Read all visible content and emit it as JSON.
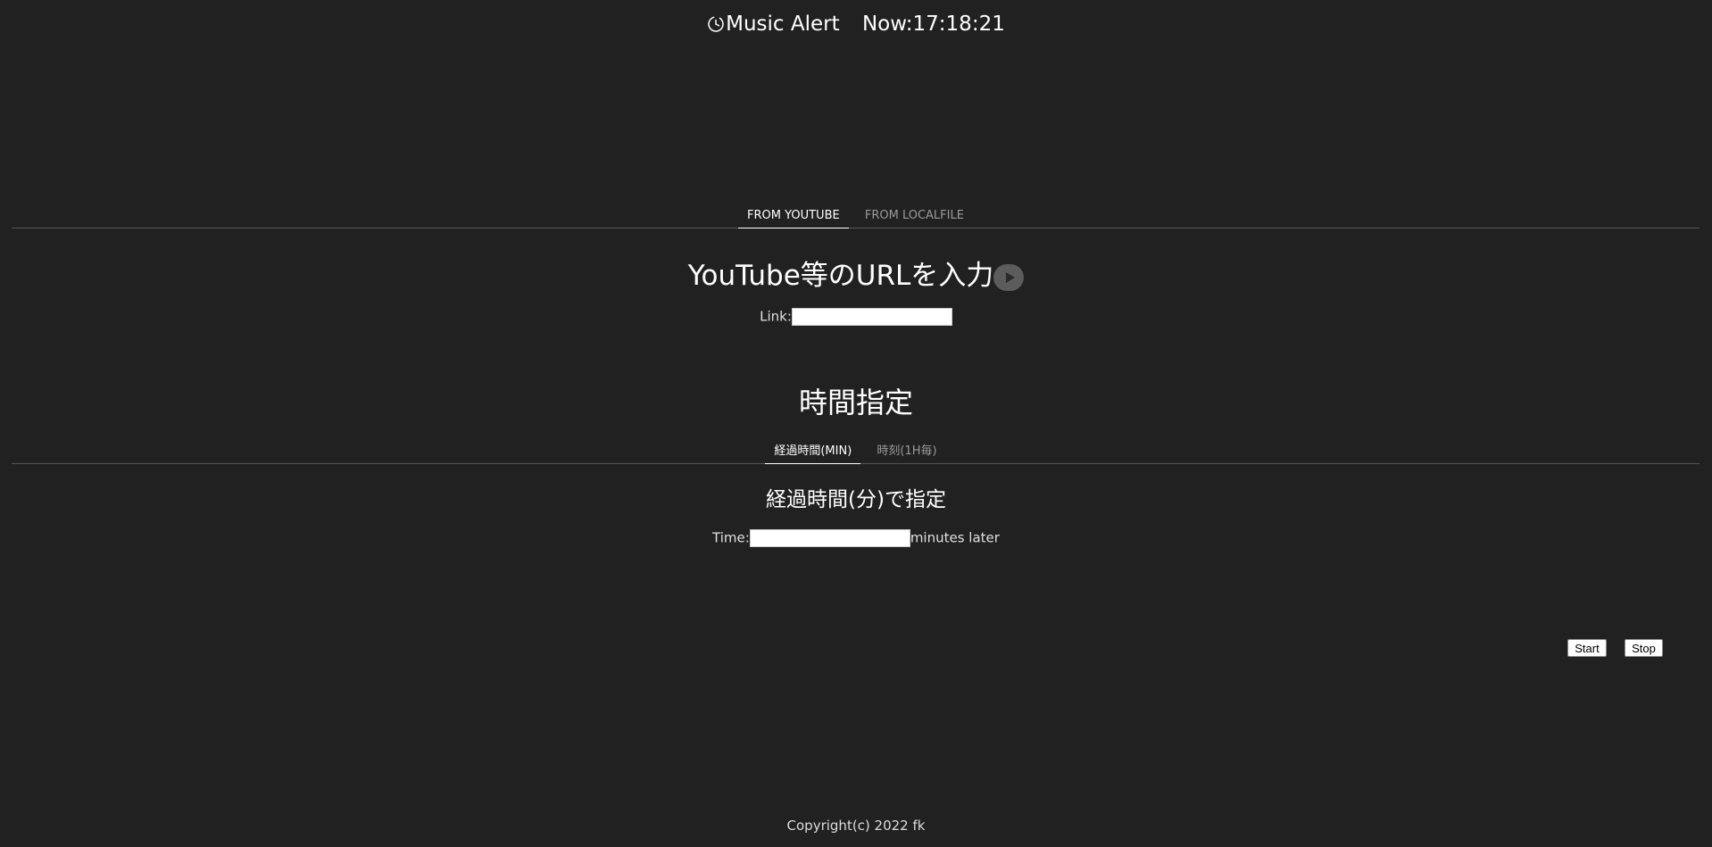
{
  "header": {
    "clock_icon": "clock-icon",
    "title": "Music Alert",
    "now_label": "Now:17:18:21"
  },
  "source_tabs": [
    {
      "label": "FROM YOUTUBE",
      "active": true
    },
    {
      "label": "FROM LOCALFILE",
      "active": false
    }
  ],
  "youtube": {
    "heading": "YouTube等のURLを入力",
    "icon": "youtube-play-icon",
    "link_label": "Link:",
    "link_value": ""
  },
  "time": {
    "heading": "時間指定",
    "tabs": [
      {
        "label": "経過時間(MIN)",
        "active": true
      },
      {
        "label": "時刻(1H毎)",
        "active": false
      }
    ],
    "elapsed_heading": "経過時間(分)で指定",
    "time_label": "Time:",
    "time_value": "",
    "suffix": "minutes later"
  },
  "buttons": {
    "start": "Start",
    "stop": "Stop"
  },
  "footer": {
    "copyright": "Copyright(c) 2022 fk"
  }
}
